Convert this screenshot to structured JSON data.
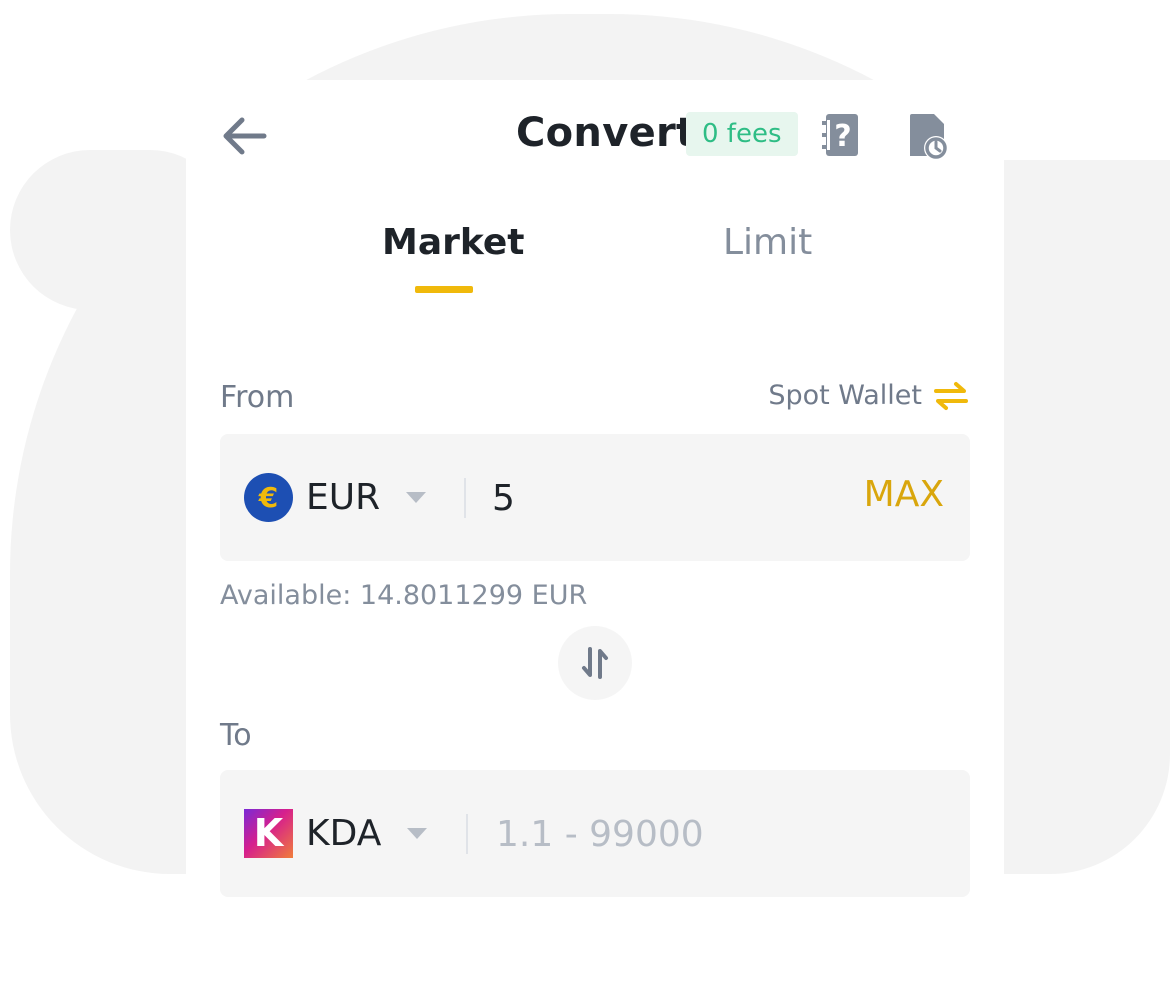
{
  "header": {
    "title": "Convert",
    "fees_badge": "0 fees",
    "icons": [
      "back-arrow-icon",
      "help-icon",
      "order-history-icon"
    ]
  },
  "tabs": [
    {
      "label": "Market",
      "active": true
    },
    {
      "label": "Limit",
      "active": false
    }
  ],
  "from": {
    "label": "From",
    "wallet_label": "Spot Wallet",
    "coin": "EUR",
    "coin_icon_glyph": "€",
    "amount": "5",
    "max_label": "MAX",
    "available": "Available: 14.8011299 EUR"
  },
  "to": {
    "label": "To",
    "coin": "KDA",
    "coin_icon_glyph": "K",
    "placeholder": "1.1 - 99000"
  },
  "colors": {
    "accent": "#f0b90b",
    "fees_green": "#2ebd85",
    "text_primary": "#1e2329",
    "text_secondary": "#707a8a"
  }
}
